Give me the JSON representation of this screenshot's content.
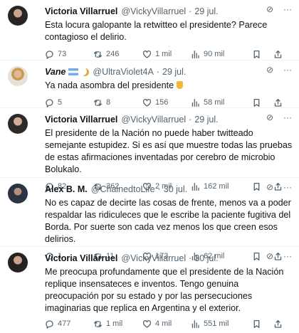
{
  "tweets": [
    {
      "name": "Victoria Villarruel",
      "handle": "@VickyVillarruel",
      "date": "29 jul.",
      "text": "Esta locura galopante la retwitteo el presidente? Parece contagioso el delirio.",
      "replies": "73",
      "retweets": "246",
      "likes": "1 mil",
      "views": "90 mil"
    },
    {
      "name": "Vane",
      "handle": "@UltraViolet4A",
      "date": "29 jul.",
      "text": "Ya nada asombra del presidente",
      "replies": "5",
      "retweets": "8",
      "likes": "156",
      "views": "58 mil"
    },
    {
      "name": "Victoria Villarruel",
      "handle": "@VickyVillarruel",
      "date": "29 jul.",
      "text": "El presidente de la Nación no puede haber twitteado semejante estupidez. Si es así que muestre todas las pruebas de estas afirmaciones inventadas por cerebro de microbio Bolukalo.",
      "replies": "82",
      "retweets": "362",
      "likes": "2 mil",
      "views": "162 mil"
    },
    {
      "name": "Alex B. M.",
      "handle": "@ChainedtoLife",
      "date": "30 jul.",
      "text": "No es capaz de decirte las cosas de frente, menos va a poder respaldar las ridiculeces que le escribe la paciente fugitiva del Borda. Por suerte son cada vez menos los que creen esos delirios.",
      "replies": "1",
      "retweets": "11",
      "likes": "173",
      "views": "62 mil"
    },
    {
      "name": "Victoria Villarruel",
      "handle": "@VickyVillarruel",
      "date": "30 jul.",
      "text": "Me preocupa profundamente que el presidente de la Nación replique insensateces e inventos. Tengo genuina preocupación por su estado y por las persecuciones imaginarias que replica en Argentina y el exterior.",
      "replies": "477",
      "retweets": "1 mil",
      "likes": "4 mil",
      "views": "551 mil"
    }
  ],
  "icons": {
    "more": "more-icon",
    "grok": "grok-icon",
    "reply": "reply-icon",
    "retweet": "retweet-icon",
    "like": "heart-icon",
    "views": "views-icon",
    "bookmark": "bookmark-icon",
    "share": "share-icon"
  },
  "colors": {
    "text": "#0f1419",
    "muted": "#536471",
    "divider": "#eff3f4"
  }
}
